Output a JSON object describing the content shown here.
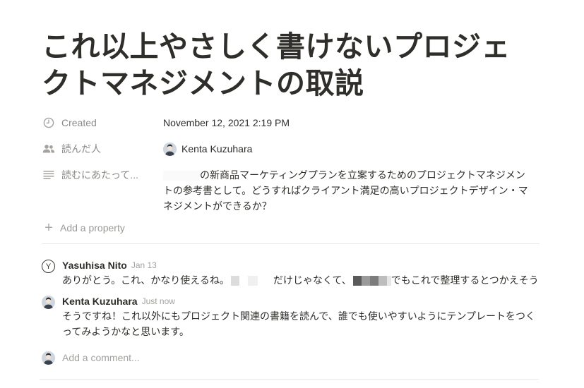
{
  "page": {
    "title": "これ以上やさしく書けないプロジェクトマネジメントの取説"
  },
  "properties": {
    "created": {
      "label": "Created",
      "icon": "clock-icon",
      "value": "November 12, 2021 2:19 PM"
    },
    "reader": {
      "label": "読んだ人",
      "icon": "people-icon",
      "value": "Kenta Kuzuhara"
    },
    "reason": {
      "label": "読むにあたって...",
      "icon": "text-lines-icon",
      "value": "の新商品マーケティングプランを立案するためのプロジェクトマネジメントの参考書として。どうすればクライアント満足の高いプロジェクトデザイン・マネジメントができるか？"
    },
    "add_property": "Add a property"
  },
  "comments": [
    {
      "author": "Yasuhisa Nito",
      "avatar_letter": "Y",
      "time": "Jan 13",
      "text_a": "ありがとう。これ、かなり使えるね。",
      "text_b": "だけじゃなくて、",
      "text_c": "でもこれで整理するとつかえそう"
    },
    {
      "author": "Kenta Kuzuhara",
      "time": "Just now",
      "text": "そうですね！これ以外にもプロジェクト関連の書籍を読んで、誰でも使いやすいようにテンプレートをつくってみようかなと思います。"
    }
  ],
  "add_comment": {
    "placeholder": "Add a comment..."
  },
  "colors": {
    "text": "#37352f",
    "muted": "#8a8985",
    "divider": "#e9e9e7",
    "background": "#ffffff"
  }
}
